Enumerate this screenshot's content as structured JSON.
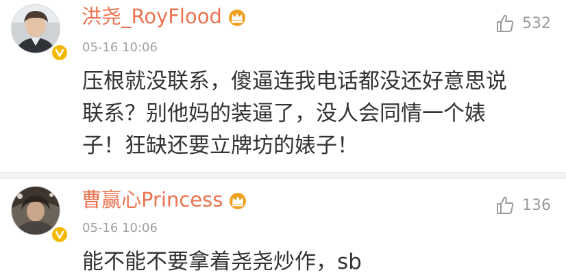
{
  "comments": [
    {
      "username": "洪尧_RoyFlood",
      "timestamp": "05-16 10:06",
      "likes": "532",
      "lines": [
        "压根就没联系，傻逼连我电话都没还好意思说",
        "联系？别他妈的装逼了，没人会同情一个婊",
        "子！狂缺还要立牌坊的婊子！"
      ]
    },
    {
      "username": "曹赢心Princess",
      "timestamp": "05-16 10:06",
      "likes": "136",
      "lines": [
        "能不能不要拿着尧尧炒作，sb"
      ]
    }
  ],
  "icons": {
    "verified": "verified-v-badge-icon",
    "member": "member-crown-icon",
    "like": "thumbs-up-icon"
  },
  "colors": {
    "username": "#eb7350",
    "badge": "#f5b800",
    "timestamp": "#a0a0a0",
    "body": "#333333",
    "like": "#9a9a9a"
  }
}
